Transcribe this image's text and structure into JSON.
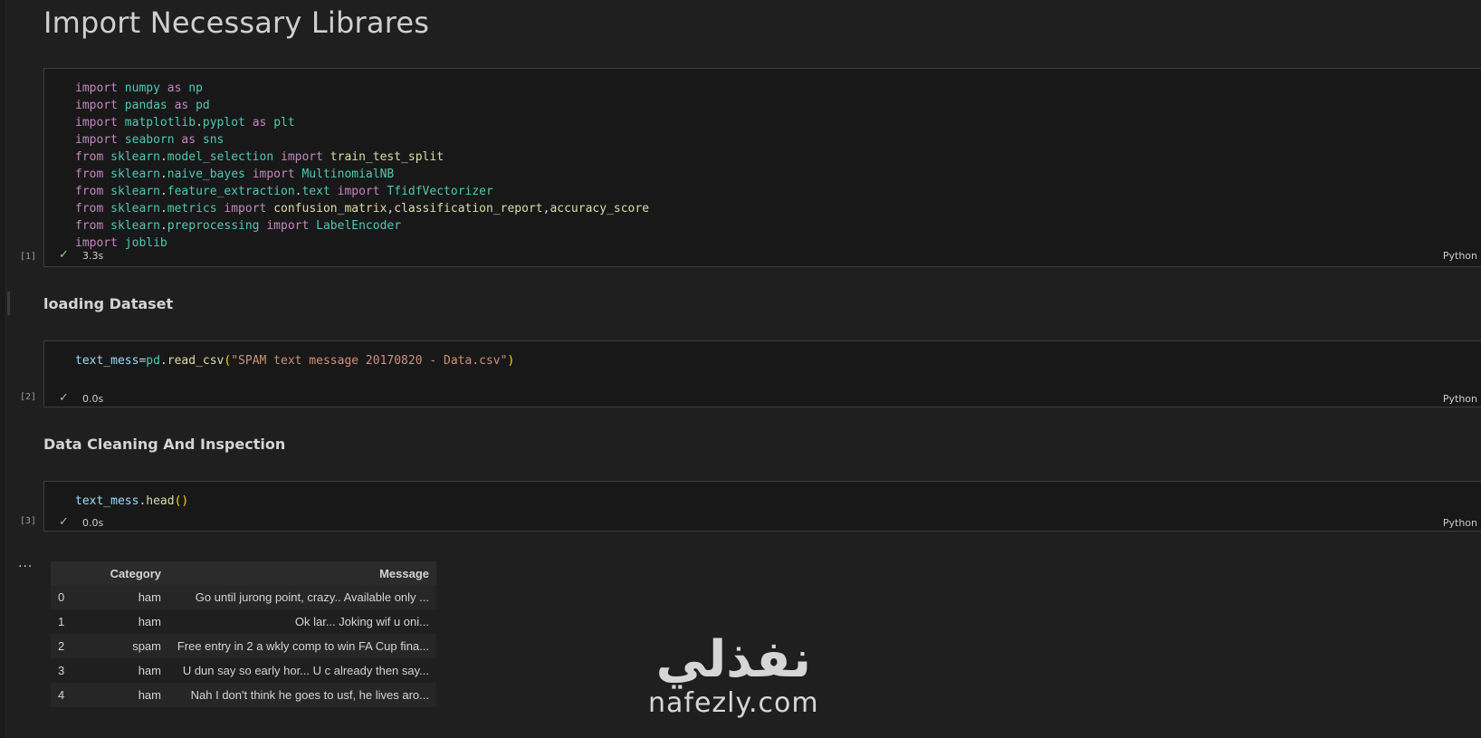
{
  "headings": {
    "title": "Import Necessary Librares",
    "loading": "loading Dataset",
    "cleaning": "Data Cleaning And Inspection"
  },
  "cells": [
    {
      "exec_count": "[1]",
      "duration": "3.3s",
      "language": "Python",
      "lines": [
        [
          [
            "kw",
            "import"
          ],
          [
            "t",
            " "
          ],
          [
            "mod",
            "numpy"
          ],
          [
            "t",
            " "
          ],
          [
            "kw",
            "as"
          ],
          [
            "t",
            " "
          ],
          [
            "mod",
            "np"
          ]
        ],
        [
          [
            "kw",
            "import"
          ],
          [
            "t",
            " "
          ],
          [
            "mod",
            "pandas"
          ],
          [
            "t",
            " "
          ],
          [
            "kw",
            "as"
          ],
          [
            "t",
            " "
          ],
          [
            "mod",
            "pd"
          ]
        ],
        [
          [
            "kw",
            "import"
          ],
          [
            "t",
            " "
          ],
          [
            "mod",
            "matplotlib"
          ],
          [
            "t",
            "."
          ],
          [
            "mod",
            "pyplot"
          ],
          [
            "t",
            " "
          ],
          [
            "kw",
            "as"
          ],
          [
            "t",
            " "
          ],
          [
            "mod",
            "plt"
          ]
        ],
        [
          [
            "kw",
            "import"
          ],
          [
            "t",
            " "
          ],
          [
            "mod",
            "seaborn"
          ],
          [
            "t",
            " "
          ],
          [
            "kw",
            "as"
          ],
          [
            "t",
            " "
          ],
          [
            "mod",
            "sns"
          ]
        ],
        [
          [
            "kw",
            "from"
          ],
          [
            "t",
            " "
          ],
          [
            "mod",
            "sklearn"
          ],
          [
            "t",
            "."
          ],
          [
            "mod",
            "model_selection"
          ],
          [
            "t",
            " "
          ],
          [
            "kw",
            "import"
          ],
          [
            "t",
            " "
          ],
          [
            "fn",
            "train_test_split"
          ]
        ],
        [
          [
            "kw",
            "from"
          ],
          [
            "t",
            " "
          ],
          [
            "mod",
            "sklearn"
          ],
          [
            "t",
            "."
          ],
          [
            "mod",
            "naive_bayes"
          ],
          [
            "t",
            " "
          ],
          [
            "kw",
            "import"
          ],
          [
            "t",
            " "
          ],
          [
            "mod",
            "MultinomialNB"
          ]
        ],
        [
          [
            "kw",
            "from"
          ],
          [
            "t",
            " "
          ],
          [
            "mod",
            "sklearn"
          ],
          [
            "t",
            "."
          ],
          [
            "mod",
            "feature_extraction"
          ],
          [
            "t",
            "."
          ],
          [
            "mod",
            "text"
          ],
          [
            "t",
            " "
          ],
          [
            "kw",
            "import"
          ],
          [
            "t",
            " "
          ],
          [
            "mod",
            "TfidfVectorizer"
          ]
        ],
        [
          [
            "kw",
            "from"
          ],
          [
            "t",
            " "
          ],
          [
            "mod",
            "sklearn"
          ],
          [
            "t",
            "."
          ],
          [
            "mod",
            "metrics"
          ],
          [
            "t",
            " "
          ],
          [
            "kw",
            "import"
          ],
          [
            "t",
            " "
          ],
          [
            "fn",
            "confusion_matrix"
          ],
          [
            "t",
            ","
          ],
          [
            "fn",
            "classification_report"
          ],
          [
            "t",
            ","
          ],
          [
            "fn",
            "accuracy_score"
          ]
        ],
        [
          [
            "kw",
            "from"
          ],
          [
            "t",
            " "
          ],
          [
            "mod",
            "sklearn"
          ],
          [
            "t",
            "."
          ],
          [
            "mod",
            "preprocessing"
          ],
          [
            "t",
            " "
          ],
          [
            "kw",
            "import"
          ],
          [
            "t",
            " "
          ],
          [
            "mod",
            "LabelEncoder"
          ]
        ],
        [
          [
            "kw",
            "import"
          ],
          [
            "t",
            " "
          ],
          [
            "mod",
            "joblib"
          ]
        ]
      ]
    },
    {
      "exec_count": "[2]",
      "duration": "0.0s",
      "language": "Python",
      "lines": [
        [
          [
            "var",
            "text_mess"
          ],
          [
            "t",
            "="
          ],
          [
            "mod",
            "pd"
          ],
          [
            "t",
            "."
          ],
          [
            "fn",
            "read_csv"
          ],
          [
            "paren",
            "("
          ],
          [
            "str",
            "\"SPAM text message 20170820 - Data.csv\""
          ],
          [
            "paren",
            ")"
          ]
        ]
      ]
    },
    {
      "exec_count": "[3]",
      "duration": "0.0s",
      "language": "Python",
      "lines": [
        [
          [
            "var",
            "text_mess"
          ],
          [
            "t",
            "."
          ],
          [
            "fn",
            "head"
          ],
          [
            "paren",
            "()"
          ]
        ]
      ]
    }
  ],
  "output": {
    "ellipsis": "···",
    "columns": [
      "",
      "Category",
      "Message"
    ],
    "rows": [
      [
        "0",
        "ham",
        "Go until jurong point, crazy.. Available only ..."
      ],
      [
        "1",
        "ham",
        "Ok lar... Joking wif u oni..."
      ],
      [
        "2",
        "spam",
        "Free entry in 2 a wkly comp to win FA Cup fina..."
      ],
      [
        "3",
        "ham",
        "U dun say so early hor... U c already then say..."
      ],
      [
        "4",
        "ham",
        "Nah I don't think he goes to usf, he lives aro..."
      ]
    ]
  },
  "watermark": {
    "arabic": "نفذلي",
    "latin": "nafezly.com"
  },
  "icons": {
    "status": "check-icon"
  }
}
